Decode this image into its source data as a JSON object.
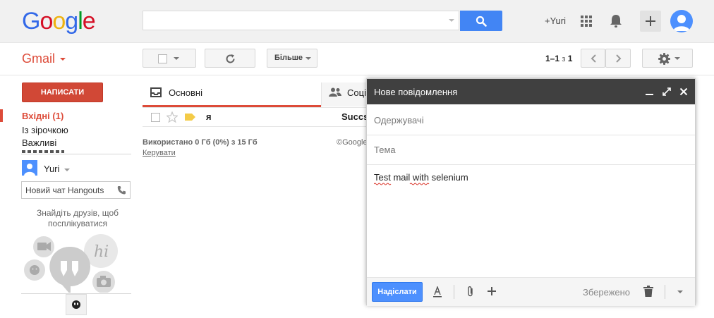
{
  "header": {
    "logo_letters": [
      {
        "ch": "G",
        "color": "#3369e8"
      },
      {
        "ch": "o",
        "color": "#d50f25"
      },
      {
        "ch": "o",
        "color": "#eeb211"
      },
      {
        "ch": "g",
        "color": "#3369e8"
      },
      {
        "ch": "l",
        "color": "#009925"
      },
      {
        "ch": "e",
        "color": "#d50f25"
      }
    ],
    "search_value": "",
    "user_link": "+Yuri",
    "icons": [
      "search-icon",
      "apps-grid-icon",
      "notifications-bell-icon",
      "plus-icon",
      "avatar-icon"
    ]
  },
  "app": {
    "name": "Gmail",
    "accent": "#dd4b39"
  },
  "toolbar": {
    "more_label": "Більше",
    "pagination": {
      "range": "1–1",
      "of_word": "з",
      "total": "1"
    },
    "icons": [
      "checkbox-icon",
      "refresh-icon",
      "chevron-left-icon",
      "chevron-right-icon",
      "settings-gear-icon"
    ]
  },
  "sidebar": {
    "compose_label": "НАПИСАТИ",
    "items": [
      {
        "label": "Вхідні (1)",
        "active": true
      },
      {
        "label": "Із зірочкою",
        "active": false
      },
      {
        "label": "Важливі",
        "active": false
      }
    ],
    "hangouts": {
      "user_name": "Yuri",
      "chat_placeholder": "Новий чат Hangouts",
      "find_friends": "Знайдіть друзів, щоб посплікуватися"
    }
  },
  "tabs": [
    {
      "label": "Основні",
      "icon": "inbox-tray-icon"
    },
    {
      "label": "Соціа",
      "icon": "people-icon"
    }
  ],
  "messages": [
    {
      "sender": "я",
      "subject": "Succs",
      "starred": false,
      "label_color": "#f4cb47"
    }
  ],
  "footer": {
    "storage": "Використано 0 Гб (0%) з 15 Гб",
    "manage_link": "Керувати",
    "copyright": "©Google"
  },
  "compose": {
    "title": "Нове повідомлення",
    "recipients_placeholder": "Одержувачі",
    "subject_placeholder": "Тема",
    "body": "Test mail with selenium",
    "send_label": "Надіслати",
    "saved_status": "Збережено",
    "send_color": "#4d90fe"
  }
}
